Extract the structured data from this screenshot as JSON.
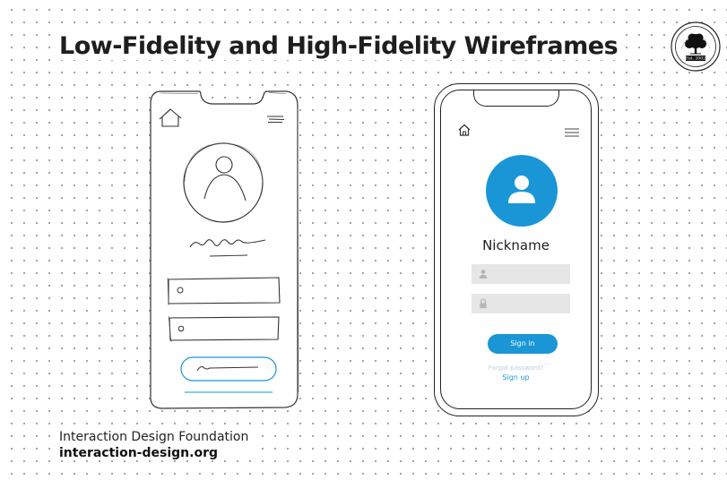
{
  "title": "Low-Fidelity and High-Fidelity Wireframes",
  "seal": {
    "text": "INTERACTION DESIGN FOUNDATION",
    "est": "Est. 2002"
  },
  "footer": {
    "organization": "Interaction Design Foundation",
    "url": "interaction-design.org"
  },
  "hifi": {
    "nickname": "Nickname",
    "signin_label": "Sign in",
    "forgot_label": "Forgot password?",
    "signup_label": "Sign up"
  },
  "colors": {
    "accent": "#1a96d6",
    "field": "#e6e6e6",
    "ink": "#222222"
  },
  "icons": {
    "home": "house-icon",
    "menu": "hamburger-menu-icon",
    "user": "user-icon",
    "lock": "lock-icon",
    "tree": "tree-icon"
  }
}
